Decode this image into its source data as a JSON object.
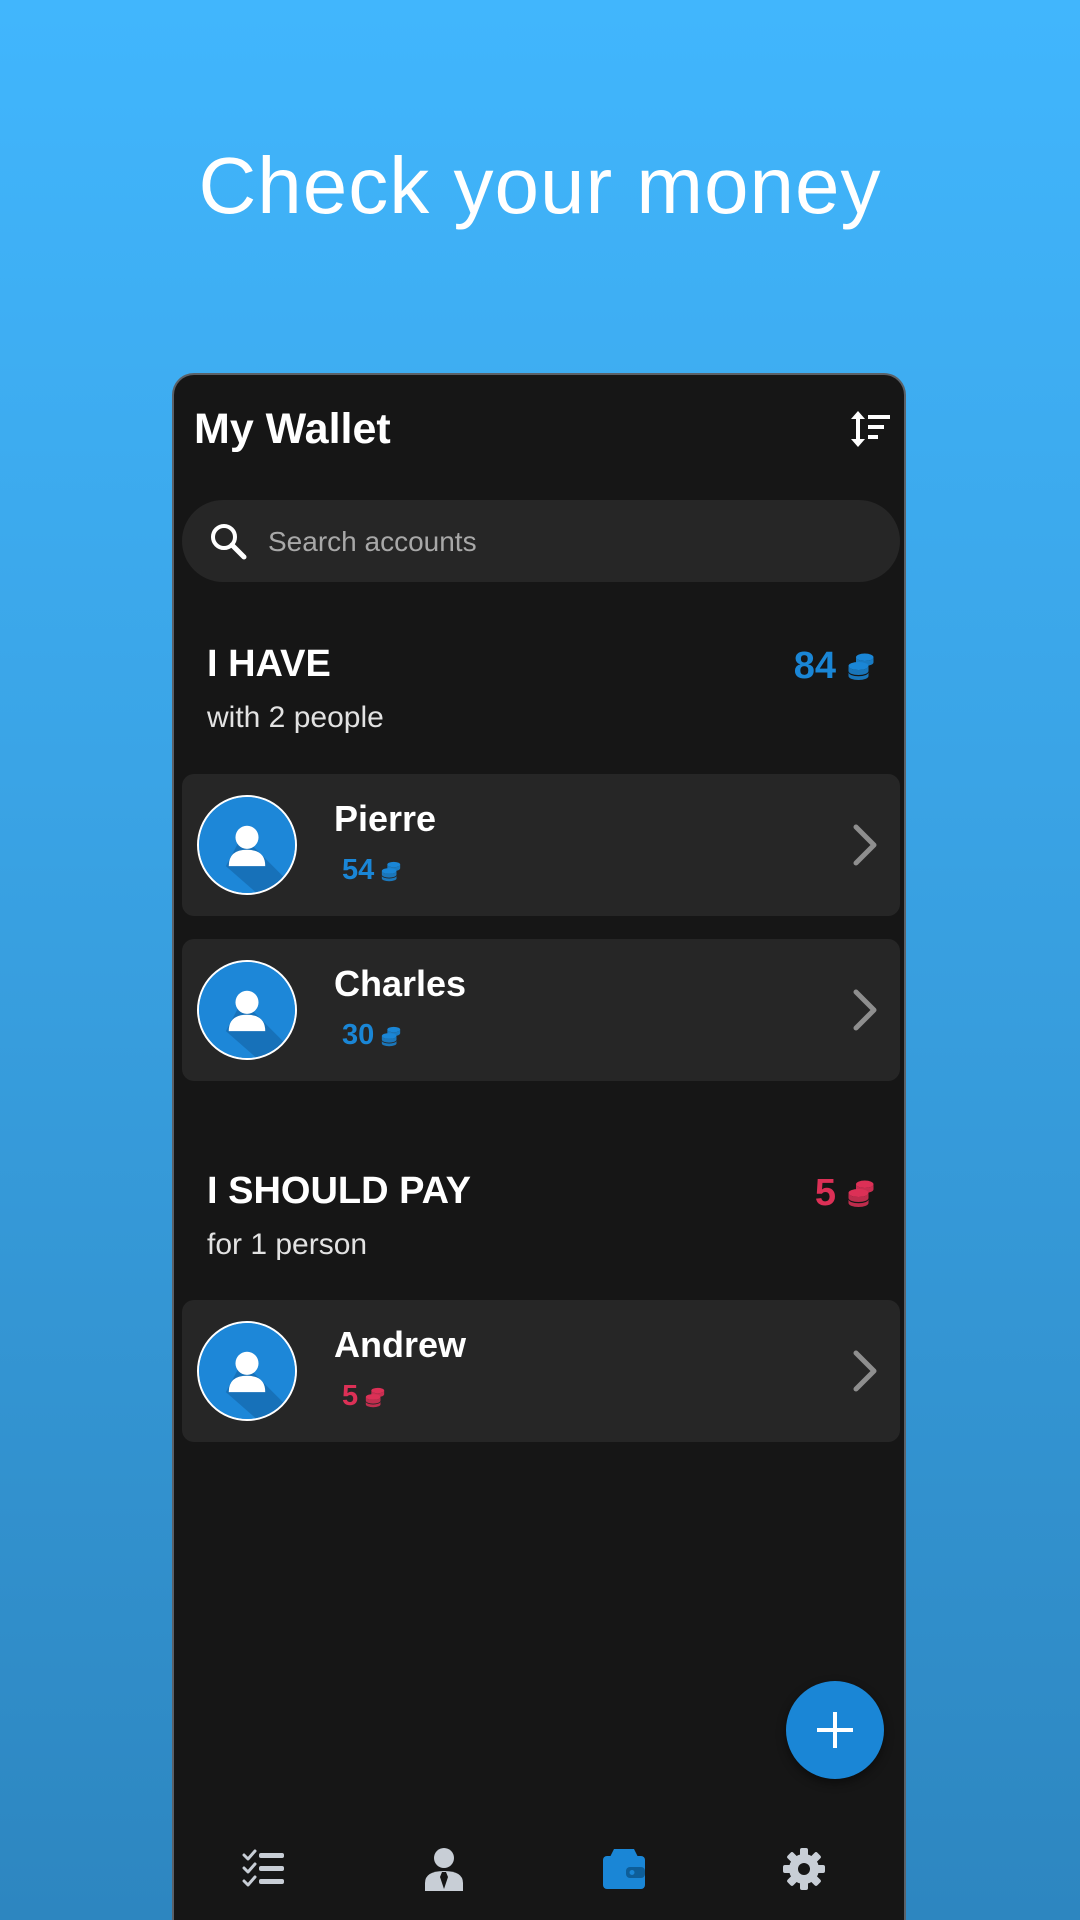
{
  "headline": "Check your money",
  "app": {
    "title": "My Wallet",
    "search": {
      "placeholder": "Search accounts",
      "value": ""
    }
  },
  "sections": [
    {
      "title": "I HAVE",
      "subtitle": "with 2 people",
      "total": "84",
      "color": "#1a86d6",
      "accounts": [
        {
          "name": "Pierre",
          "amount": "54"
        },
        {
          "name": "Charles",
          "amount": "30"
        }
      ]
    },
    {
      "title": "I SHOULD PAY",
      "subtitle": "for 1 person",
      "total": "5",
      "color": "#dc3056",
      "accounts": [
        {
          "name": "Andrew",
          "amount": "5"
        }
      ]
    }
  ],
  "icons": {
    "sort": "sort-icon",
    "search": "search-icon",
    "coins": "coins-icon",
    "avatar": "person-avatar-icon",
    "chevron": "chevron-right-icon",
    "fab": "plus-icon"
  },
  "bottom_nav": [
    {
      "icon": "checklist-icon",
      "active": false
    },
    {
      "icon": "person-tie-icon",
      "active": false
    },
    {
      "icon": "wallet-icon",
      "active": true
    },
    {
      "icon": "gear-icon",
      "active": false
    }
  ],
  "colors": {
    "background_top": "#41b6fd",
    "background_bottom": "#2d86c0",
    "phone_bg": "#161616",
    "card_bg": "#262626",
    "accent_blue": "#1a86d6",
    "accent_red": "#dc3056",
    "nav_inactive": "#c8ced6"
  }
}
